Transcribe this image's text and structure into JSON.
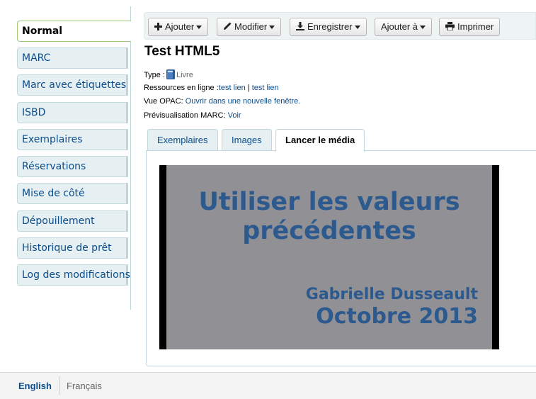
{
  "sidebar": {
    "items": [
      {
        "label": "Normal",
        "active": true
      },
      {
        "label": "MARC"
      },
      {
        "label": "Marc avec étiquettes"
      },
      {
        "label": "ISBD"
      },
      {
        "label": "Exemplaires"
      },
      {
        "label": "Réservations"
      },
      {
        "label": "Mise de côté"
      },
      {
        "label": "Dépouillement"
      },
      {
        "label": "Historique de prêt"
      },
      {
        "label": "Log des modifications"
      }
    ]
  },
  "toolbar": {
    "add_label": "Ajouter",
    "edit_label": "Modifier",
    "save_label": "Enregistrer",
    "add_to_label": "Ajouter à",
    "print_label": "Imprimer"
  },
  "record": {
    "title": "Test HTML5",
    "type_label": "Type :",
    "type_value": "Livre",
    "online_label": "Ressources en ligne :",
    "online_links": [
      "test lien",
      "test lien"
    ],
    "online_separator": " | ",
    "opac_label": "Vue OPAC:",
    "opac_link": "Ouvrir dans une nouvelle fenêtre.",
    "marc_preview_label": "Prévisualisation MARC:",
    "marc_preview_link": "Voir"
  },
  "tabs": [
    {
      "label": "Exemplaires"
    },
    {
      "label": "Images"
    },
    {
      "label": "Lancer le média",
      "active": true
    }
  ],
  "media": {
    "title_line1": "Utiliser les valeurs",
    "title_line2": "précédentes",
    "author": "Gabrielle Dusseault",
    "date": "Octobre 2013"
  },
  "footer": {
    "current_language": "English",
    "other_language": "Français"
  },
  "colors": {
    "link": "#0b4d8c",
    "slide_text": "#2d5a8e",
    "slide_background": "#909095",
    "active_tab_border": "#9ccc7a"
  }
}
